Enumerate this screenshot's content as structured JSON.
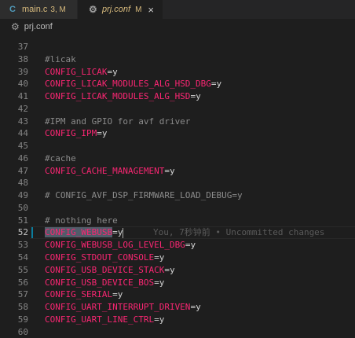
{
  "tabs": [
    {
      "icon": "c-file-icon",
      "icon_glyph": "C",
      "label": "main.c",
      "status": "3, M"
    },
    {
      "icon": "gear-icon",
      "icon_glyph": "⚙",
      "label": "prj.conf",
      "status": "M",
      "close_glyph": "×"
    }
  ],
  "breadcrumb": {
    "icon_glyph": "⚙",
    "label": "prj.conf"
  },
  "editor": {
    "lines": [
      {
        "n": "37",
        "parts": []
      },
      {
        "n": "38",
        "parts": [
          {
            "t": "#licak",
            "c": "cmt"
          }
        ]
      },
      {
        "n": "39",
        "parts": [
          {
            "t": "CONFIG_LICAK",
            "c": "key"
          },
          {
            "t": "=",
            "c": "op"
          },
          {
            "t": "y",
            "c": "val"
          }
        ]
      },
      {
        "n": "40",
        "parts": [
          {
            "t": "CONFIG_LICAK_MODULES_ALG_HSD_DBG",
            "c": "key"
          },
          {
            "t": "=",
            "c": "op"
          },
          {
            "t": "y",
            "c": "val"
          }
        ]
      },
      {
        "n": "41",
        "parts": [
          {
            "t": "CONFIG_LICAK_MODULES_ALG_HSD",
            "c": "key"
          },
          {
            "t": "=",
            "c": "op"
          },
          {
            "t": "y",
            "c": "val"
          }
        ]
      },
      {
        "n": "42",
        "parts": []
      },
      {
        "n": "43",
        "parts": [
          {
            "t": "#IPM and GPIO for avf driver",
            "c": "cmt"
          }
        ]
      },
      {
        "n": "44",
        "parts": [
          {
            "t": "CONFIG_IPM",
            "c": "key"
          },
          {
            "t": "=",
            "c": "op"
          },
          {
            "t": "y",
            "c": "val"
          }
        ]
      },
      {
        "n": "45",
        "parts": []
      },
      {
        "n": "46",
        "parts": [
          {
            "t": "#cache",
            "c": "cmt"
          }
        ]
      },
      {
        "n": "47",
        "parts": [
          {
            "t": "CONFIG_CACHE_MANAGEMENT",
            "c": "key"
          },
          {
            "t": "=",
            "c": "op"
          },
          {
            "t": "y",
            "c": "val"
          }
        ]
      },
      {
        "n": "48",
        "parts": []
      },
      {
        "n": "49",
        "parts": [
          {
            "t": "# CONFIG_AVF_DSP_FIRMWARE_LOAD_DEBUG=y",
            "c": "cmt"
          }
        ]
      },
      {
        "n": "50",
        "parts": []
      },
      {
        "n": "51",
        "parts": [
          {
            "t": "# nothing here",
            "c": "cmt"
          }
        ]
      },
      {
        "n": "52",
        "active": true,
        "parts": [
          {
            "t": "CONFIG_WEBUSB",
            "c": "key sel"
          },
          {
            "t": "=",
            "c": "op"
          },
          {
            "t": "y",
            "c": "val"
          }
        ],
        "blame": "You, 7秒钟前 • Uncommitted changes"
      },
      {
        "n": "53",
        "parts": [
          {
            "t": "CONFIG_WEBUSB_LOG_LEVEL_DBG",
            "c": "key"
          },
          {
            "t": "=",
            "c": "op"
          },
          {
            "t": "y",
            "c": "val"
          }
        ]
      },
      {
        "n": "54",
        "parts": [
          {
            "t": "CONFIG_STDOUT_CONSOLE",
            "c": "key"
          },
          {
            "t": "=",
            "c": "op"
          },
          {
            "t": "y",
            "c": "val"
          }
        ]
      },
      {
        "n": "55",
        "parts": [
          {
            "t": "CONFIG_USB_DEVICE_STACK",
            "c": "key"
          },
          {
            "t": "=",
            "c": "op"
          },
          {
            "t": "y",
            "c": "val"
          }
        ]
      },
      {
        "n": "56",
        "parts": [
          {
            "t": "CONFIG_USB_DEVICE_BOS",
            "c": "key"
          },
          {
            "t": "=",
            "c": "op"
          },
          {
            "t": "y",
            "c": "val"
          }
        ]
      },
      {
        "n": "57",
        "parts": [
          {
            "t": "CONFIG_SERIAL",
            "c": "key"
          },
          {
            "t": "=",
            "c": "op"
          },
          {
            "t": "y",
            "c": "val"
          }
        ]
      },
      {
        "n": "58",
        "parts": [
          {
            "t": "CONFIG_UART_INTERRUPT_DRIVEN",
            "c": "key"
          },
          {
            "t": "=",
            "c": "op"
          },
          {
            "t": "y",
            "c": "val"
          }
        ]
      },
      {
        "n": "59",
        "parts": [
          {
            "t": "CONFIG_UART_LINE_CTRL",
            "c": "key"
          },
          {
            "t": "=",
            "c": "op"
          },
          {
            "t": "y",
            "c": "val"
          }
        ]
      },
      {
        "n": "60",
        "parts": []
      }
    ]
  }
}
